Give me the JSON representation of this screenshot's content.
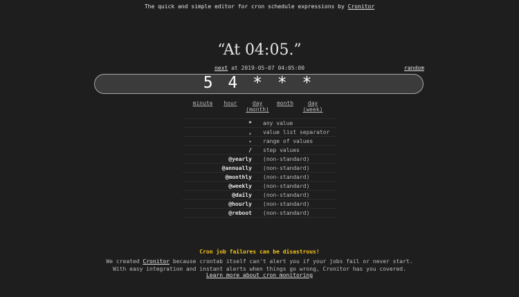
{
  "header": {
    "tagline_prefix": "The quick and simple editor for cron schedule expressions by",
    "brand_link": "Cronitor"
  },
  "description": "“At 04:05.”",
  "next_row": {
    "next_label": "next",
    "next_text": "at 2019-05-07 04:05:00",
    "random_label": "random"
  },
  "expression": "5 4 * * *",
  "parts": [
    {
      "label": "minute",
      "sub": ""
    },
    {
      "label": "hour",
      "sub": ""
    },
    {
      "label": "day",
      "sub": "(month)"
    },
    {
      "label": "month",
      "sub": ""
    },
    {
      "label": "day",
      "sub": "(week)"
    }
  ],
  "legend": [
    {
      "symbol": "*",
      "desc": "any value"
    },
    {
      "symbol": ",",
      "desc": "value list separator"
    },
    {
      "symbol": "-",
      "desc": "range of values"
    },
    {
      "symbol": "/",
      "desc": "step values"
    },
    {
      "symbol": "@yearly",
      "desc": "(non-standard)"
    },
    {
      "symbol": "@annually",
      "desc": "(non-standard)"
    },
    {
      "symbol": "@monthly",
      "desc": "(non-standard)"
    },
    {
      "symbol": "@weekly",
      "desc": "(non-standard)"
    },
    {
      "symbol": "@daily",
      "desc": "(non-standard)"
    },
    {
      "symbol": "@hourly",
      "desc": "(non-standard)"
    },
    {
      "symbol": "@reboot",
      "desc": "(non-standard)"
    }
  ],
  "cta": {
    "title": "Cron job failures can be disastrous!",
    "line1_prefix": "We created",
    "line1_link": "Cronitor",
    "line1_suffix": "because crontab itself can't alert you if your jobs fail or never start.",
    "line2": "With easy integration and instant alerts when things go wrong, Cronitor has you covered.",
    "learn_more": "Learn more about cron monitoring"
  },
  "colors": {
    "background": "#1e1e1e",
    "accent_yellow": "#f5c518",
    "input_bg": "#3b3b3b"
  }
}
